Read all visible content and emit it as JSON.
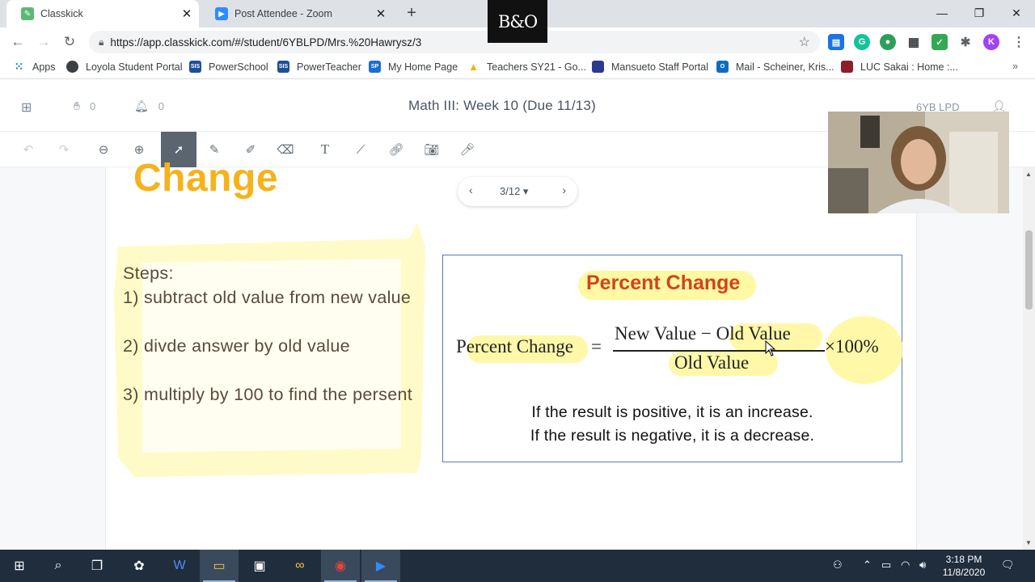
{
  "browser": {
    "tabs": [
      {
        "title": "Classkick",
        "active": true
      },
      {
        "title": "Post Attendee - Zoom",
        "active": false
      }
    ],
    "overlay_logo": "B&O",
    "url": "https://app.classkick.com/#/student/6YBLPD/Mrs.%20Hawrysz/3",
    "profile_initial": "K",
    "bookmarks": [
      "Apps",
      "Loyola Student Portal",
      "PowerSchool",
      "PowerTeacher",
      "My Home Page",
      "Teachers SY21 - Go...",
      "Mansueto Staff Portal",
      "Mail - Scheiner, Kris...",
      "LUC Sakai : Home :..."
    ],
    "bookmark_icon_text": [
      "",
      "",
      "SIS",
      "SIS",
      "SP",
      "",
      "",
      "",
      ""
    ],
    "colors": {
      "tabstrip": "#dee1e6",
      "accent": "#1a73e8"
    }
  },
  "classkick": {
    "hand_count": "0",
    "notification_count": "0",
    "assignment_title": "Math III: Week 10 (Due 11/13)",
    "user_label": "6YB LPD",
    "pager": {
      "current": "3/12"
    },
    "tools": [
      "undo-icon",
      "redo-icon",
      "zoom-out-icon",
      "zoom-in-icon",
      "select-icon",
      "pen-icon",
      "highlighter-icon",
      "eraser-icon",
      "text-icon",
      "line-icon",
      "link-icon",
      "camera-icon",
      "microphone-icon"
    ],
    "selected_tool": "select-icon"
  },
  "slide": {
    "title_fragment": "Change",
    "steps": [
      "Steps:",
      "1) subtract old value from new value",
      "",
      "2) divde answer by old value",
      "",
      "3) multiply by 100 to find the persent"
    ],
    "box_heading": "Percent Change",
    "formula": {
      "lhs": "Percent Change",
      "equals": "=",
      "numerator": "New Value − Old Value",
      "denominator": "Old Value",
      "multiplier": "×100%"
    },
    "result_positive": "If the result is positive, it is an increase.",
    "result_negative": "If the result is negative, it is a decrease.",
    "colors": {
      "title": "#f6b21a",
      "heading": "#d2441b",
      "highlight": "#fff79a",
      "steps_text": "#5a4a3a"
    }
  },
  "taskbar": {
    "time": "3:18 PM",
    "date": "11/8/2020"
  }
}
